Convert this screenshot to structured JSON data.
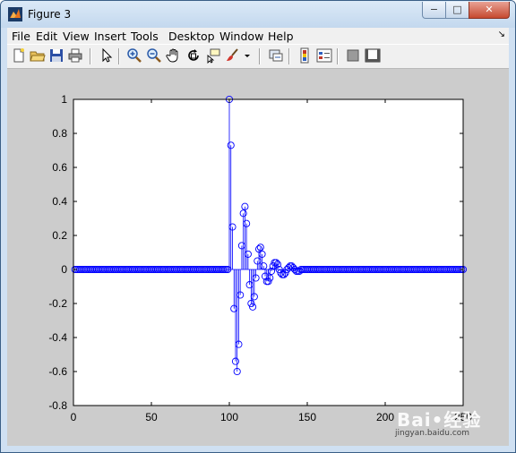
{
  "window": {
    "title": "Figure 3"
  },
  "window_controls": {
    "minimize": "−",
    "maximize": "□",
    "close": "✕"
  },
  "menu": [
    "File",
    "Edit",
    "View",
    "Insert",
    "Tools",
    "Desktop",
    "Window",
    "Help"
  ],
  "menu_dock_arrow": "↘",
  "toolbar": {
    "icons": [
      "new-figure-icon",
      "open-file-icon",
      "save-figure-icon",
      "print-figure-icon",
      "edit-plot-icon",
      "zoom-in-icon",
      "zoom-out-icon",
      "pan-icon",
      "rotate-3d-icon",
      "data-cursor-icon",
      "brush-icon",
      "link-plot-icon",
      "insert-colorbar-icon",
      "insert-legend-icon",
      "hide-plot-tools-icon",
      "show-plot-tools-icon"
    ]
  },
  "watermark": {
    "brand": "Bai•经验",
    "url": "jingyan.baidu.com"
  },
  "colors": {
    "stem": "#0000ff",
    "figure_bg": "#cccccc",
    "axes_bg": "#ffffff"
  },
  "chart_data": {
    "type": "stem",
    "title": "",
    "xlabel": "",
    "ylabel": "",
    "xlim": [
      0,
      250
    ],
    "ylim": [
      -0.8,
      1
    ],
    "xticks": [
      0,
      50,
      100,
      150,
      200,
      250
    ],
    "yticks": [
      -0.8,
      -0.6,
      -0.4,
      -0.2,
      0,
      0.2,
      0.4,
      0.6,
      0.8,
      1
    ],
    "xticklabels": [
      "0",
      "50",
      "100",
      "150",
      "200",
      "250"
    ],
    "yticklabels": [
      "-0.8",
      "-0.6",
      "-0.4",
      "-0.2",
      "0",
      "0.2",
      "0.4",
      "0.6",
      "0.8",
      "1"
    ],
    "grid": false,
    "series": [
      {
        "marker": "circle",
        "x_range": [
          1,
          250
        ],
        "baseline_value": 0,
        "points": [
          {
            "x": 100,
            "y": 1.0
          },
          {
            "x": 101,
            "y": 0.73
          },
          {
            "x": 102,
            "y": 0.25
          },
          {
            "x": 103,
            "y": -0.23
          },
          {
            "x": 104,
            "y": -0.54
          },
          {
            "x": 105,
            "y": -0.6
          },
          {
            "x": 106,
            "y": -0.44
          },
          {
            "x": 107,
            "y": -0.15
          },
          {
            "x": 108,
            "y": 0.14
          },
          {
            "x": 109,
            "y": 0.33
          },
          {
            "x": 110,
            "y": 0.37
          },
          {
            "x": 111,
            "y": 0.27
          },
          {
            "x": 112,
            "y": 0.09
          },
          {
            "x": 113,
            "y": -0.09
          },
          {
            "x": 114,
            "y": -0.2
          },
          {
            "x": 115,
            "y": -0.22
          },
          {
            "x": 116,
            "y": -0.16
          },
          {
            "x": 117,
            "y": -0.05
          },
          {
            "x": 118,
            "y": 0.05
          },
          {
            "x": 119,
            "y": 0.12
          },
          {
            "x": 120,
            "y": 0.13
          },
          {
            "x": 121,
            "y": 0.09
          },
          {
            "x": 122,
            "y": 0.02
          },
          {
            "x": 123,
            "y": -0.04
          },
          {
            "x": 124,
            "y": -0.07
          },
          {
            "x": 125,
            "y": -0.07
          },
          {
            "x": 126,
            "y": -0.05
          },
          {
            "x": 127,
            "y": -0.01
          },
          {
            "x": 128,
            "y": 0.02
          },
          {
            "x": 129,
            "y": 0.04
          },
          {
            "x": 130,
            "y": 0.04
          },
          {
            "x": 131,
            "y": 0.03
          },
          {
            "x": 132,
            "y": 0.0
          },
          {
            "x": 133,
            "y": -0.02
          },
          {
            "x": 134,
            "y": -0.03
          },
          {
            "x": 135,
            "y": -0.03
          },
          {
            "x": 136,
            "y": -0.02
          },
          {
            "x": 137,
            "y": 0.0
          },
          {
            "x": 138,
            "y": 0.01
          },
          {
            "x": 139,
            "y": 0.02
          },
          {
            "x": 140,
            "y": 0.02
          },
          {
            "x": 141,
            "y": 0.01
          },
          {
            "x": 142,
            "y": 0.0
          },
          {
            "x": 143,
            "y": -0.01
          },
          {
            "x": 144,
            "y": -0.01
          },
          {
            "x": 145,
            "y": -0.01
          }
        ]
      }
    ]
  }
}
